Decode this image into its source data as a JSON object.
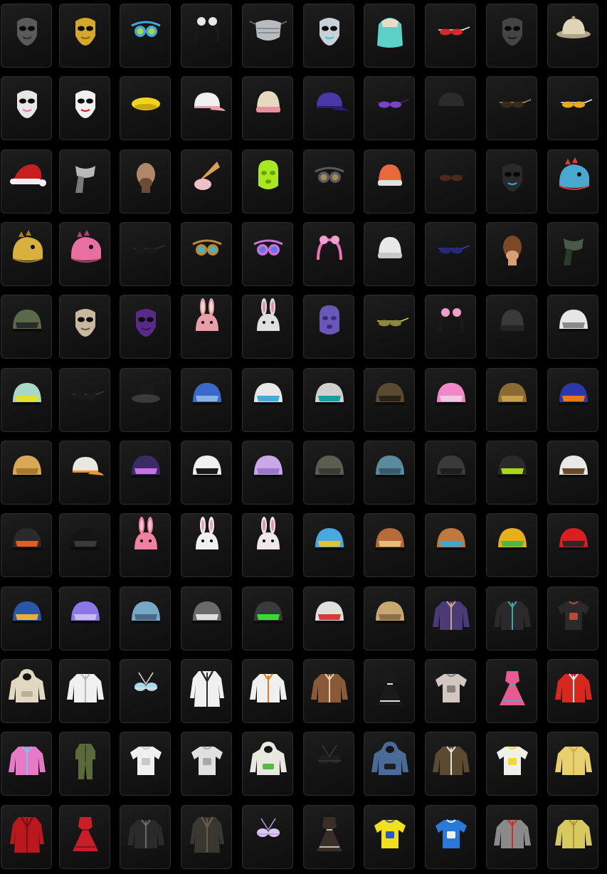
{
  "inventory": {
    "items": [
      {
        "icon": "tactical-mask-icon",
        "type": "mask",
        "c1": "#5a5a5a",
        "c2": "#2c2c2c"
      },
      {
        "icon": "golden-venetian-mask-icon",
        "type": "mask",
        "c1": "#d4a82a",
        "c2": "#8a6a10"
      },
      {
        "icon": "tech-goggles-icon",
        "type": "goggles",
        "c1": "#3fa9d8",
        "c2": "#b6d23a"
      },
      {
        "icon": "panda-headband-icon",
        "type": "headband",
        "c1": "#1a1a1a",
        "c2": "#e8e8e8"
      },
      {
        "icon": "silver-face-mask-icon",
        "type": "facemask",
        "c1": "#b8bcc0",
        "c2": "#7c8084"
      },
      {
        "icon": "cyber-mask-icon",
        "type": "mask",
        "c1": "#c8d0d8",
        "c2": "#39c7d6"
      },
      {
        "icon": "teal-hair-icon",
        "type": "hair",
        "c1": "#5dd0c8",
        "c2": "#e8dcc8"
      },
      {
        "icon": "red-sunglasses-icon",
        "type": "glasses",
        "c1": "#d82828",
        "c2": "#e6e6e6"
      },
      {
        "icon": "skull-mask-icon",
        "type": "mask",
        "c1": "#454545",
        "c2": "#1e1e1e"
      },
      {
        "icon": "pith-helmet-icon",
        "type": "pith",
        "c1": "#e0d4b8",
        "c2": "#b0a488"
      },
      {
        "icon": "pink-skull-mask-icon",
        "type": "mask",
        "c1": "#e6e6e6",
        "c2": "#e078b0"
      },
      {
        "icon": "clown-mask-icon",
        "type": "mask",
        "c1": "#f0f0f0",
        "c2": "#c81e1e"
      },
      {
        "icon": "yellow-beret-icon",
        "type": "beret",
        "c1": "#f2d41e",
        "c2": "#c8a80a"
      },
      {
        "icon": "bunny-cap-icon",
        "type": "cap",
        "c1": "#f0f0f0",
        "c2": "#e8a0b0"
      },
      {
        "icon": "earmuff-beanie-icon",
        "type": "beanie",
        "c1": "#e8d8c0",
        "c2": "#e890a0"
      },
      {
        "icon": "purple-cap-icon",
        "type": "cap",
        "c1": "#4a38a8",
        "c2": "#2a1e70"
      },
      {
        "icon": "purple-glasses-icon",
        "type": "glasses",
        "c1": "#7a44c8",
        "c2": "#3a2a60"
      },
      {
        "icon": "black-cap-icon",
        "type": "cap",
        "c1": "#2a2a2a",
        "c2": "#141414"
      },
      {
        "icon": "aviator-sunglasses-icon",
        "type": "glasses",
        "c1": "#3a2a1a",
        "c2": "#a88a4a"
      },
      {
        "icon": "gold-visor-glasses-icon",
        "type": "glasses",
        "c1": "#e8a81e",
        "c2": "#e6e6e6"
      },
      {
        "icon": "santa-hat-icon",
        "type": "santa",
        "c1": "#c81e1e",
        "c2": "#f0f0f0"
      },
      {
        "icon": "gray-scarf-icon",
        "type": "scarf",
        "c1": "#b8b8b8",
        "c2": "#7a7a7a"
      },
      {
        "icon": "bald-head-icon",
        "type": "head",
        "c1": "#b08868",
        "c2": "#6a4a38"
      },
      {
        "icon": "ice-cream-hat-icon",
        "type": "cone",
        "c1": "#d8a050",
        "c2": "#f0c0c8"
      },
      {
        "icon": "green-balaclava-icon",
        "type": "balaclava",
        "c1": "#a8e81e",
        "c2": "#6aa00a"
      },
      {
        "icon": "gas-mask-icon",
        "type": "goggles",
        "c1": "#5a5a5a",
        "c2": "#a88a5a"
      },
      {
        "icon": "orange-beanie-icon",
        "type": "beanie",
        "c1": "#e86a3a",
        "c2": "#e0e0e0"
      },
      {
        "icon": "brown-round-glasses-icon",
        "type": "glasses",
        "c1": "#4a2a1a",
        "c2": "#2a1a10"
      },
      {
        "icon": "blue-chevron-mask-icon",
        "type": "mask",
        "c1": "#2a2a2a",
        "c2": "#2aa8e8"
      },
      {
        "icon": "dino-hat-icon",
        "type": "dino",
        "c1": "#48a8d0",
        "c2": "#e03a3a"
      },
      {
        "icon": "yellow-dino-head-icon",
        "type": "dino",
        "c1": "#d8b040",
        "c2": "#a88020"
      },
      {
        "icon": "pink-dino-head-icon",
        "type": "dino",
        "c1": "#e870a0",
        "c2": "#b84070"
      },
      {
        "icon": "black-glasses-icon",
        "type": "glasses",
        "c1": "#1a1a1a",
        "c2": "#303030"
      },
      {
        "icon": "steampunk-goggles-icon",
        "type": "goggles",
        "c1": "#b88a3a",
        "c2": "#3ab8c8"
      },
      {
        "icon": "purple-gas-mask-icon",
        "type": "goggles",
        "c1": "#c870d8",
        "c2": "#5a78e8"
      },
      {
        "icon": "pink-bow-headband-icon",
        "type": "headband",
        "c1": "#f070b8",
        "c2": "#f0a0d0"
      },
      {
        "icon": "white-bear-beanie-icon",
        "type": "beanie",
        "c1": "#e8e8e8",
        "c2": "#c8c8c8"
      },
      {
        "icon": "navy-glasses-icon",
        "type": "glasses",
        "c1": "#28287a",
        "c2": "#3a3aa8"
      },
      {
        "icon": "chimp-mask-icon",
        "type": "head",
        "c1": "#7a4a28",
        "c2": "#d8a070"
      },
      {
        "icon": "camo-bandana-icon",
        "type": "scarf",
        "c1": "#4a5a48",
        "c2": "#2a3a2a"
      },
      {
        "icon": "headset-helmet-icon",
        "type": "helmet",
        "c1": "#5a6a48",
        "c2": "#2a2a2a"
      },
      {
        "icon": "bone-mask-icon",
        "type": "mask",
        "c1": "#c8b8a0",
        "c2": "#6a5a48"
      },
      {
        "icon": "purple-tactical-mask-icon",
        "type": "mask",
        "c1": "#5a2a8a",
        "c2": "#2a1a48"
      },
      {
        "icon": "bunny-head-icon",
        "type": "bunny",
        "c1": "#e8a0a8",
        "c2": "#f0e0d0"
      },
      {
        "icon": "bunny-gas-mask-icon",
        "type": "bunny",
        "c1": "#e0e0e0",
        "c2": "#e890a0"
      },
      {
        "icon": "purple-hood-mask-icon",
        "type": "balaclava",
        "c1": "#6a58b8",
        "c2": "#3a2a80"
      },
      {
        "icon": "yellow-rim-glasses-icon",
        "type": "glasses",
        "c1": "#8a8a3a",
        "c2": "#d8c83a"
      },
      {
        "icon": "bunny-ears-headband-icon",
        "type": "headband",
        "c1": "#1a1a1a",
        "c2": "#f0a0c8"
      },
      {
        "icon": "black-beanie-icon",
        "type": "beanie",
        "c1": "#3a3a3a",
        "c2": "#242424"
      },
      {
        "icon": "white-trooper-helmet-icon",
        "type": "helmet",
        "c1": "#e6e6e6",
        "c2": "#8a8a8a"
      },
      {
        "icon": "teal-headphone-helmet-icon",
        "type": "helmet",
        "c1": "#a8d8c8",
        "c2": "#e0e030"
      },
      {
        "icon": "wire-glasses-icon",
        "type": "glasses",
        "c1": "#1a1a1a",
        "c2": "#3a3a3a"
      },
      {
        "icon": "bucket-hat-icon",
        "type": "bucket",
        "c1": "#1a1a1a",
        "c2": "#3a3a3a"
      },
      {
        "icon": "blue-knight-helmet-icon",
        "type": "helmet",
        "c1": "#3a6ac8",
        "c2": "#8ab0e8"
      },
      {
        "icon": "white-splash-helmet-icon",
        "type": "helmet",
        "c1": "#e8e8e8",
        "c2": "#48a8d8"
      },
      {
        "icon": "racing-helmet-icon",
        "type": "helmet",
        "c1": "#d0d0d0",
        "c2": "#18a0a0"
      },
      {
        "icon": "aviator-cap-icon",
        "type": "helmet",
        "c1": "#5a4a30",
        "c2": "#2a2418"
      },
      {
        "icon": "pink-ice-cream-helmet-icon",
        "type": "helmet",
        "c1": "#f088c8",
        "c2": "#f0c8e0"
      },
      {
        "icon": "brown-goggle-helmet-icon",
        "type": "helmet",
        "c1": "#8a6a30",
        "c2": "#c8a048"
      },
      {
        "icon": "blue-orange-helmet-icon",
        "type": "helmet",
        "c1": "#2a38a8",
        "c2": "#e87a1e"
      },
      {
        "icon": "shiba-helmet-icon",
        "type": "helmet",
        "c1": "#d8a858",
        "c2": "#a87830"
      },
      {
        "icon": "orange-cap-icon",
        "type": "cap",
        "c1": "#e8e8e0",
        "c2": "#e89838"
      },
      {
        "icon": "purple-horned-helmet-icon",
        "type": "helmet",
        "c1": "#3a2a68",
        "c2": "#c870e8"
      },
      {
        "icon": "panda-helmet-icon",
        "type": "helmet",
        "c1": "#f0f0f0",
        "c2": "#1a1a1a"
      },
      {
        "icon": "lavender-helmet-icon",
        "type": "helmet",
        "c1": "#c8a8e8",
        "c2": "#9a78c8"
      },
      {
        "icon": "olive-helmet-icon",
        "type": "helmet",
        "c1": "#5a5e50",
        "c2": "#3a3c34"
      },
      {
        "icon": "blue-camo-helmet-icon",
        "type": "helmet",
        "c1": "#5a8aa0",
        "c2": "#3a5a6a"
      },
      {
        "icon": "black-combat-helmet-icon",
        "type": "helmet",
        "c1": "#3a3a3a",
        "c2": "#1e1e1e"
      },
      {
        "icon": "green-number-helmet-icon",
        "type": "helmet",
        "c1": "#2a2a2a",
        "c2": "#a8d818"
      },
      {
        "icon": "astronaut-helmet-icon",
        "type": "helmet",
        "c1": "#e8e8e8",
        "c2": "#6a4a28"
      },
      {
        "icon": "motocross-helmet-icon",
        "type": "helmet",
        "c1": "#2a2a2a",
        "c2": "#e85a1e"
      },
      {
        "icon": "black-moto-helmet-icon",
        "type": "helmet",
        "c1": "#141414",
        "c2": "#3a3a3a"
      },
      {
        "icon": "pink-bunny-helmet-icon",
        "type": "bunny",
        "c1": "#f080a0",
        "c2": "#f0c8d8"
      },
      {
        "icon": "white-bunny-helmet-icon",
        "type": "bunny",
        "c1": "#f0f0f0",
        "c2": "#f0a0b0"
      },
      {
        "icon": "cony-helmet-icon",
        "type": "bunny",
        "c1": "#f0e8e8",
        "c2": "#e890a8"
      },
      {
        "icon": "blue-bear-helmet-icon",
        "type": "helmet",
        "c1": "#48a8e0",
        "c2": "#e8c02a"
      },
      {
        "icon": "brown-bear-helmet-icon",
        "type": "helmet",
        "c1": "#b86a38",
        "c2": "#e0c07a"
      },
      {
        "icon": "bear-cyan-helmet-icon",
        "type": "helmet",
        "c1": "#c07840",
        "c2": "#38a8d8"
      },
      {
        "icon": "tiger-helmet-icon",
        "type": "helmet",
        "c1": "#e8b018",
        "c2": "#48b848"
      },
      {
        "icon": "red-moto-helmet-icon",
        "type": "helmet",
        "c1": "#d81e1e",
        "c2": "#2a2a2a"
      },
      {
        "icon": "blue-samurai-helmet-icon",
        "type": "helmet",
        "c1": "#2a58a8",
        "c2": "#e8b038"
      },
      {
        "icon": "purple-level3-helmet-icon",
        "type": "helmet",
        "c1": "#8a78e8",
        "c2": "#c8b8f0"
      },
      {
        "icon": "blue-level3-helmet-icon",
        "type": "helmet",
        "c1": "#78a8c8",
        "c2": "#4a6a8a"
      },
      {
        "icon": "horned-level3-helmet-icon",
        "type": "helmet",
        "c1": "#6a6a6a",
        "c2": "#e0e0e0"
      },
      {
        "icon": "spiked-green-helmet-icon",
        "type": "helmet",
        "c1": "#3a3a3a",
        "c2": "#38d838"
      },
      {
        "icon": "red-horned-helmet-icon",
        "type": "helmet",
        "c1": "#e0e0e0",
        "c2": "#d83838"
      },
      {
        "icon": "tan-level3-helmet-icon",
        "type": "helmet",
        "c1": "#c8a870",
        "c2": "#8a7048"
      },
      {
        "icon": "purple-bomber-jacket-icon",
        "type": "jacket",
        "c1": "#4a3a78",
        "c2": "#c8a888"
      },
      {
        "icon": "dark-racing-jacket-icon",
        "type": "jacket",
        "c1": "#2a2a2a",
        "c2": "#38a8a8"
      },
      {
        "icon": "graphic-tshirt-icon",
        "type": "tshirt",
        "c1": "#2a2a2a",
        "c2": "#b8483a"
      },
      {
        "icon": "cream-hoodie-icon",
        "type": "hoodie",
        "c1": "#e0d8c0",
        "c2": "#b8b098"
      },
      {
        "icon": "white-jacket-icon",
        "type": "jacket",
        "c1": "#f0f0f0",
        "c2": "#b8b8b8"
      },
      {
        "icon": "blue-bikini-top-icon",
        "type": "bikini",
        "c1": "#a8d8e8",
        "c2": "#e0e0e0"
      },
      {
        "icon": "zebra-coat-icon",
        "type": "coat",
        "c1": "#f0f0f0",
        "c2": "#2a2a2a"
      },
      {
        "icon": "astronaut-jacket-icon",
        "type": "jacket",
        "c1": "#f0f0f0",
        "c2": "#e8781e"
      },
      {
        "icon": "shearling-jacket-icon",
        "type": "jacket",
        "c1": "#8a5a38",
        "c2": "#e0d0b8"
      },
      {
        "icon": "maid-outfit-icon",
        "type": "dress",
        "c1": "#1a1a1a",
        "c2": "#e0e0e0"
      },
      {
        "icon": "sailor-shirt-icon",
        "type": "tshirt",
        "c1": "#d0c8c0",
        "c2": "#8a8278"
      },
      {
        "icon": "pop-art-dress-icon",
        "type": "dress",
        "c1": "#e85a90",
        "c2": "#48a8e0"
      },
      {
        "icon": "red-varsity-jacket-icon",
        "type": "jacket",
        "c1": "#d8281e",
        "c2": "#f0f0f0"
      },
      {
        "icon": "pink-crop-sweater-icon",
        "type": "jacket",
        "c1": "#e878c8",
        "c2": "#78c8e8"
      },
      {
        "icon": "green-jumpsuit-icon",
        "type": "jumpsuit",
        "c1": "#5a6a38",
        "c2": "#3a4a28"
      },
      {
        "icon": "white-tshirt-icon",
        "type": "tshirt",
        "c1": "#f0f0f0",
        "c2": "#c8c8c8"
      },
      {
        "icon": "gray-tshirt-icon",
        "type": "tshirt",
        "c1": "#e0e0e0",
        "c2": "#a8a8a8"
      },
      {
        "icon": "sprout-hoodie-icon",
        "type": "hoodie",
        "c1": "#e8e8e0",
        "c2": "#58b848"
      },
      {
        "icon": "black-corset-top-icon",
        "type": "bikini",
        "c1": "#1e1e1e",
        "c2": "#3a3a3a"
      },
      {
        "icon": "blue-denim-hoodie-icon",
        "type": "hoodie",
        "c1": "#4a6a98",
        "c2": "#1e1e1e"
      },
      {
        "icon": "utility-vest-icon",
        "type": "jacket",
        "c1": "#5a4a30",
        "c2": "#e0e0e0"
      },
      {
        "icon": "yellow-cartoon-tshirt-icon",
        "type": "tshirt",
        "c1": "#f0f0e8",
        "c2": "#f0d838"
      },
      {
        "icon": "yellow-sweater-icon",
        "type": "jacket",
        "c1": "#e8d070",
        "c2": "#c8b050"
      },
      {
        "icon": "red-leather-coat-icon",
        "type": "coat",
        "c1": "#b8181e",
        "c2": "#781014"
      },
      {
        "icon": "red-dress-icon",
        "type": "dress",
        "c1": "#c81e28",
        "c2": "#881018"
      },
      {
        "icon": "black-patterned-jacket-icon",
        "type": "jacket",
        "c1": "#2a2a2a",
        "c2": "#6a6a6a"
      },
      {
        "icon": "dark-trench-coat-icon",
        "type": "coat",
        "c1": "#3a3632",
        "c2": "#6a5a48"
      },
      {
        "icon": "lavender-bikini-icon",
        "type": "bikini",
        "c1": "#d8c8f0",
        "c2": "#b0a0d8"
      },
      {
        "icon": "gothic-dress-icon",
        "type": "dress",
        "c1": "#3a2e2a",
        "c2": "#c8b8a8"
      },
      {
        "icon": "yellow-team-jersey-icon",
        "type": "tshirt",
        "c1": "#f0e01e",
        "c2": "#2a58c8"
      },
      {
        "icon": "hawaiian-shirt-icon",
        "type": "tshirt",
        "c1": "#2a78d8",
        "c2": "#f0f0f0"
      },
      {
        "icon": "gray-red-jacket-icon",
        "type": "jacket",
        "c1": "#8a8a8a",
        "c2": "#d82828"
      },
      {
        "icon": "olive-yellow-jacket-icon",
        "type": "jacket",
        "c1": "#d8c860",
        "c2": "#a89838"
      }
    ]
  }
}
